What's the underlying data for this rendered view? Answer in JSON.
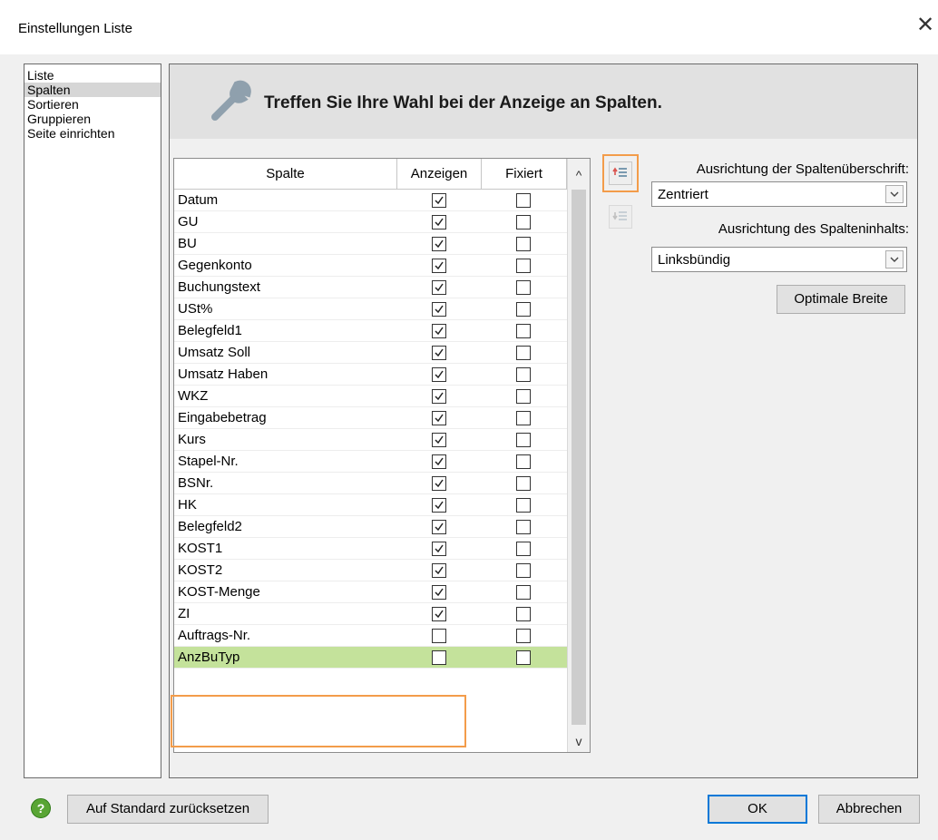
{
  "window": {
    "title": "Einstellungen Liste",
    "close_glyph": "✕"
  },
  "nav": {
    "items": [
      {
        "label": "Liste",
        "selected": false
      },
      {
        "label": "Spalten",
        "selected": true
      },
      {
        "label": "Sortieren",
        "selected": false
      },
      {
        "label": "Gruppieren",
        "selected": false
      },
      {
        "label": "Seite einrichten",
        "selected": false
      }
    ]
  },
  "panel": {
    "heading": "Treffen Sie Ihre Wahl bei der Anzeige an Spalten.",
    "icon": "wrench-icon"
  },
  "grid": {
    "headers": {
      "spalte": "Spalte",
      "anzeigen": "Anzeigen",
      "fixiert": "Fixiert"
    },
    "rows": [
      {
        "name": "Datum",
        "anzeigen": true,
        "fixiert": false
      },
      {
        "name": "GU",
        "anzeigen": true,
        "fixiert": false
      },
      {
        "name": "BU",
        "anzeigen": true,
        "fixiert": false
      },
      {
        "name": "Gegenkonto",
        "anzeigen": true,
        "fixiert": false
      },
      {
        "name": "Buchungstext",
        "anzeigen": true,
        "fixiert": false
      },
      {
        "name": "USt%",
        "anzeigen": true,
        "fixiert": false
      },
      {
        "name": "Belegfeld1",
        "anzeigen": true,
        "fixiert": false
      },
      {
        "name": "Umsatz Soll",
        "anzeigen": true,
        "fixiert": false
      },
      {
        "name": "Umsatz Haben",
        "anzeigen": true,
        "fixiert": false
      },
      {
        "name": "WKZ",
        "anzeigen": true,
        "fixiert": false
      },
      {
        "name": "Eingabebetrag",
        "anzeigen": true,
        "fixiert": false
      },
      {
        "name": "Kurs",
        "anzeigen": true,
        "fixiert": false
      },
      {
        "name": "Stapel-Nr.",
        "anzeigen": true,
        "fixiert": false
      },
      {
        "name": "BSNr.",
        "anzeigen": true,
        "fixiert": false
      },
      {
        "name": "HK",
        "anzeigen": true,
        "fixiert": false
      },
      {
        "name": "Belegfeld2",
        "anzeigen": true,
        "fixiert": false
      },
      {
        "name": "KOST1",
        "anzeigen": true,
        "fixiert": false
      },
      {
        "name": "KOST2",
        "anzeigen": true,
        "fixiert": false
      },
      {
        "name": "KOST-Menge",
        "anzeigen": true,
        "fixiert": false
      },
      {
        "name": "ZI",
        "anzeigen": true,
        "fixiert": false
      },
      {
        "name": "Auftrags-Nr.",
        "anzeigen": false,
        "fixiert": false
      },
      {
        "name": "AnzBuTyp",
        "anzeigen": false,
        "fixiert": false,
        "selected": true
      }
    ],
    "scroll_up_glyph": "^",
    "scroll_down_glyph": "v"
  },
  "settings": {
    "header_alignment_label": "Ausrichtung der Spaltenüberschrift:",
    "header_alignment_value": "Zentriert",
    "content_alignment_label": "Ausrichtung des Spalteninhalts:",
    "content_alignment_value": "Linksbündig",
    "optimal_width_label": "Optimale Breite"
  },
  "footer": {
    "help_glyph": "?",
    "reset_label": "Auf Standard zurücksetzen",
    "ok_label": "OK",
    "cancel_label": "Abbrechen"
  },
  "colors": {
    "selected_row": "#c4e29b",
    "highlight_box": "#f39c4a",
    "move_arrow": "#d9534f",
    "help_green": "#59a534"
  }
}
